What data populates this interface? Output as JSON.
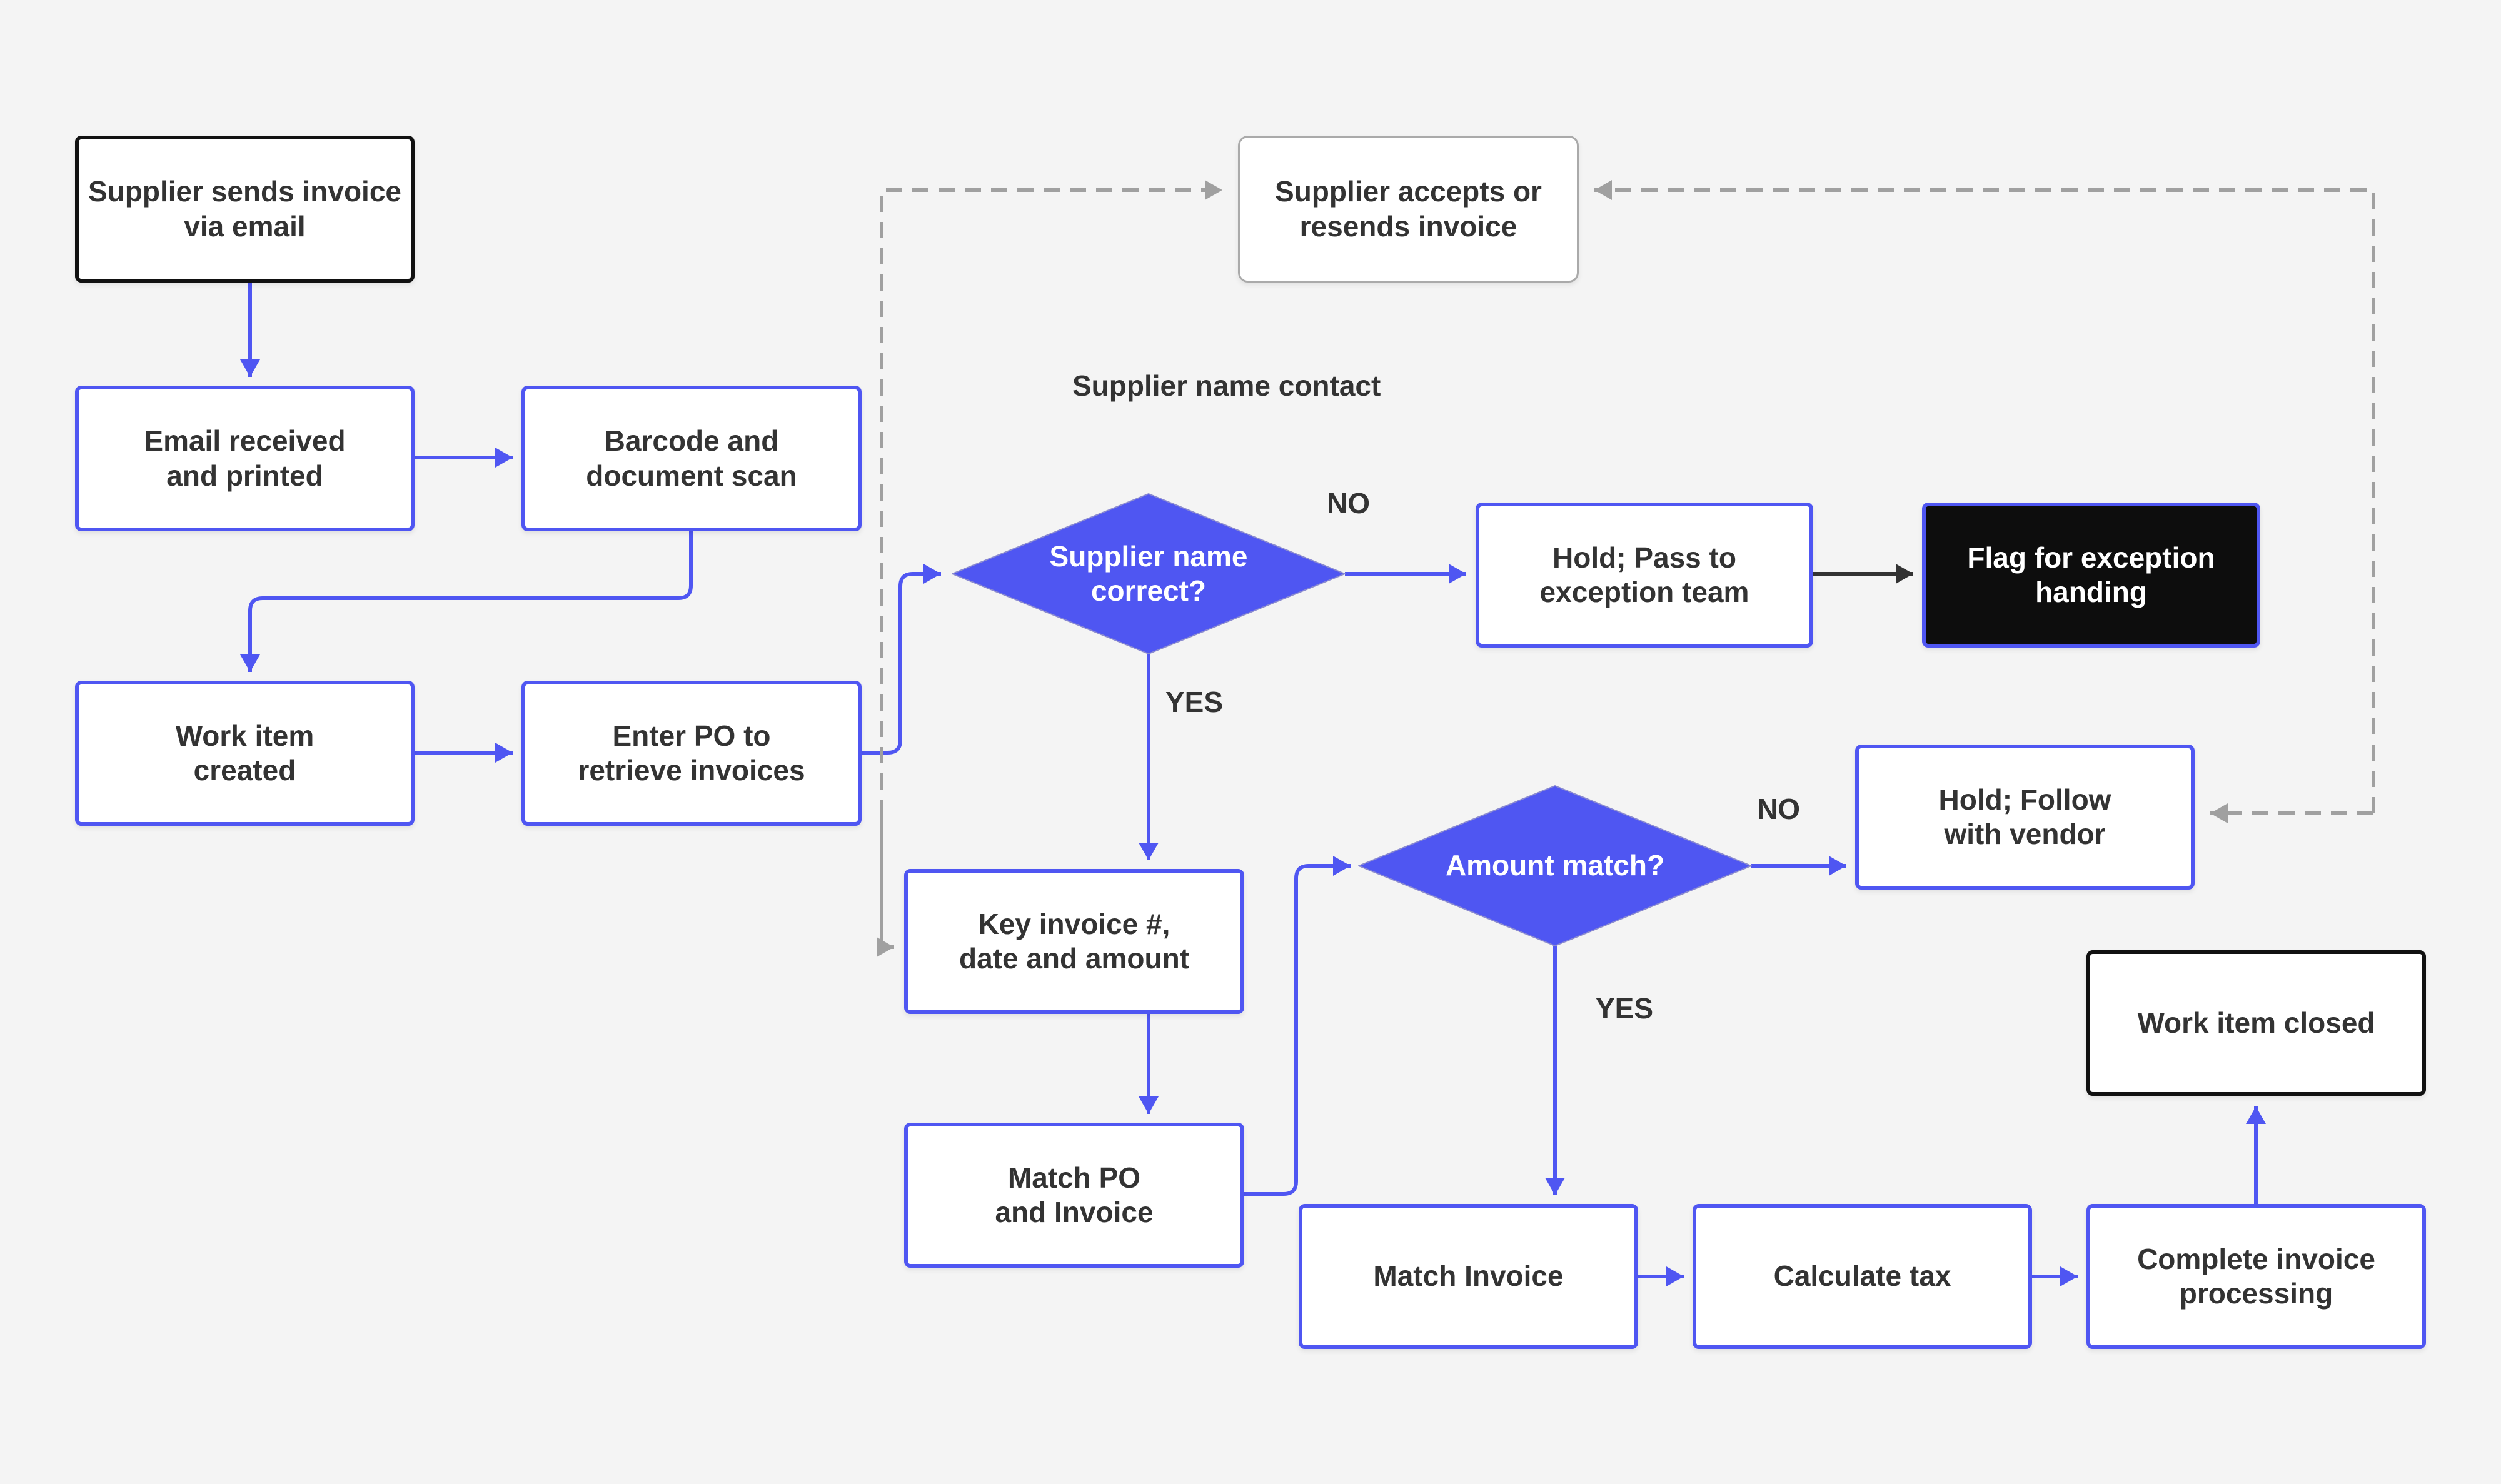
{
  "colors": {
    "accent": "#4f56f2",
    "background": "#f4f4f4",
    "dashed": "#a0a0a0",
    "dark_node": "#0d0d0d"
  },
  "nodes": {
    "supplier_sends": "Supplier sends invoice\nvia email",
    "email_received": "Email received\nand printed",
    "barcode_scan": "Barcode and\ndocument scan",
    "work_item_created": "Work item\ncreated",
    "enter_po": "Enter PO to\nretrieve invoices",
    "supplier_accepts": "Supplier accepts or\nresends invoice",
    "supplier_name_correct": "Supplier name\ncorrect?",
    "hold_pass": "Hold; Pass to\nexception team",
    "flag_exception": "Flag for exception\nhanding",
    "key_invoice": "Key invoice #,\ndate and amount",
    "match_po": "Match PO\nand Invoice",
    "amount_match": "Amount match?",
    "hold_follow": "Hold; Follow\nwith vendor",
    "work_item_closed": "Work item closed",
    "match_invoice": "Match Invoice",
    "calculate_tax": "Calculate tax",
    "complete_processing": "Complete invoice\nprocessing"
  },
  "labels": {
    "supplier_name_contact": "Supplier name contact",
    "no_1": "NO",
    "yes_1": "YES",
    "no_2": "NO",
    "yes_2": "YES"
  }
}
